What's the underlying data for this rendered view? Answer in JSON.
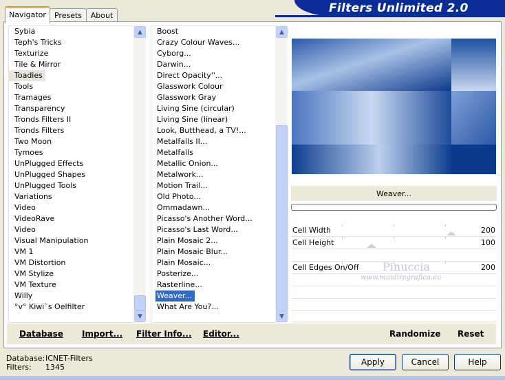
{
  "banner": {
    "title": "Filters Unlimited 2.0"
  },
  "tabs": [
    {
      "label": "Navigator",
      "active": true
    },
    {
      "label": "Presets",
      "active": false
    },
    {
      "label": "About",
      "active": false
    }
  ],
  "categories": {
    "items": [
      "Sybia",
      "Teph's Tricks",
      "Texturize",
      "Tile & Mirror",
      "Toadies",
      "Tools",
      "Tramages",
      "Transparency",
      "Tronds Filters II",
      "Tronds Filters",
      "Two Moon",
      "Tymoes",
      "UnPlugged Effects",
      "UnPlugged Shapes",
      "UnPlugged Tools",
      "Variations",
      "Video",
      "VideoRave",
      "Video",
      "Visual Manipulation",
      "VM 1",
      "VM Distortion",
      "VM Stylize",
      "VM Texture",
      "Willy",
      "°v° Kiwi`s Oelfilter"
    ],
    "selected": "Toadies"
  },
  "filters": {
    "items": [
      "Boost",
      "Crazy Colour Waves...",
      "Cyborg...",
      "Darwin...",
      "Direct Opacity''...",
      "Glasswork Colour",
      "Glasswork Gray",
      "Living Sine (circular)",
      "Living Sine (linear)",
      "Look, Butthead, a TV!...",
      "Metalfalls II...",
      "Metalfalls",
      "Metallic Onion...",
      "Metalwork...",
      "Motion Trail...",
      "Old Photo...",
      "Ommadawn...",
      "Picasso's Another Word...",
      "Picasso's Last Word...",
      "Plain Mosaic 2...",
      "Plain Mosaic Blur...",
      "Plain Mosaic...",
      "Posterize...",
      "Rasterline...",
      "Weaver...",
      "What Are You?..."
    ],
    "selected": "Weaver..."
  },
  "preview": {
    "filter_name": "Weaver..."
  },
  "params": [
    {
      "label": "Cell Width",
      "value": "200"
    },
    {
      "label": "Cell Height",
      "value": "100"
    },
    {
      "label": "Cell Edges On/Off",
      "value": "200"
    }
  ],
  "watermark": {
    "line1": "Pinuccia",
    "line2": "www.maidiregrafica.eu"
  },
  "bottom_buttons": {
    "database": "Database",
    "import": "Import...",
    "filter_info": "Filter Info...",
    "editor": "Editor...",
    "randomize": "Randomize",
    "reset": "Reset"
  },
  "status": {
    "database_label": "Database:",
    "database_value": "ICNET-Filters",
    "filters_label": "Filters:",
    "filters_value": "1345"
  },
  "dialog_buttons": {
    "apply": "Apply",
    "cancel": "Cancel",
    "help": "Help"
  },
  "colors": {
    "banner": "#0a2c96",
    "selection": "#316ac5",
    "preview_dark": "#0b3a8c",
    "preview_light": "#c7d6ee"
  }
}
